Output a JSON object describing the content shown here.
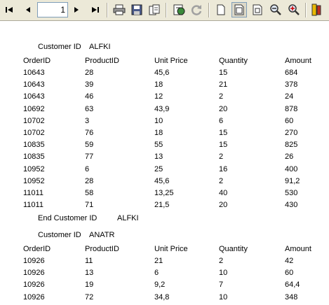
{
  "toolbar": {
    "page_number": "1",
    "buttons": [
      {
        "name": "first-page-icon"
      },
      {
        "name": "previous-page-icon"
      },
      {
        "name": "next-page-icon"
      },
      {
        "name": "last-page-icon"
      },
      {
        "name": "print-icon"
      },
      {
        "name": "save-icon"
      },
      {
        "name": "export-icon"
      },
      {
        "name": "stop-icon"
      },
      {
        "name": "refresh-icon"
      },
      {
        "name": "single-page-icon"
      },
      {
        "name": "page-width-icon"
      },
      {
        "name": "whole-page-icon"
      },
      {
        "name": "zoom-out-icon"
      },
      {
        "name": "zoom-in-icon"
      },
      {
        "name": "close-icon"
      }
    ]
  },
  "report": {
    "groups": [
      {
        "header_label": "Customer ID",
        "customer_id": "ALFKI",
        "columns": [
          "OrderID",
          "ProductID",
          "Unit Price",
          "Quantity",
          "Amount"
        ],
        "rows": [
          [
            "10643",
            "28",
            "45,6",
            "15",
            "684"
          ],
          [
            "10643",
            "39",
            "18",
            "21",
            "378"
          ],
          [
            "10643",
            "46",
            "12",
            "2",
            "24"
          ],
          [
            "10692",
            "63",
            "43,9",
            "20",
            "878"
          ],
          [
            "10702",
            "3",
            "10",
            "6",
            "60"
          ],
          [
            "10702",
            "76",
            "18",
            "15",
            "270"
          ],
          [
            "10835",
            "59",
            "55",
            "15",
            "825"
          ],
          [
            "10835",
            "77",
            "13",
            "2",
            "26"
          ],
          [
            "10952",
            "6",
            "25",
            "16",
            "400"
          ],
          [
            "10952",
            "28",
            "45,6",
            "2",
            "91,2"
          ],
          [
            "11011",
            "58",
            "13,25",
            "40",
            "530"
          ],
          [
            "11011",
            "71",
            "21,5",
            "20",
            "430"
          ]
        ],
        "footer_label": "End Customer ID",
        "footer_id": "ALFKI"
      },
      {
        "header_label": "Customer ID",
        "customer_id": "ANATR",
        "columns": [
          "OrderID",
          "ProductID",
          "Unit Price",
          "Quantity",
          "Amount"
        ],
        "rows": [
          [
            "10926",
            "11",
            "21",
            "2",
            "42"
          ],
          [
            "10926",
            "13",
            "6",
            "10",
            "60"
          ],
          [
            "10926",
            "19",
            "9,2",
            "7",
            "64,4"
          ],
          [
            "10926",
            "72",
            "34,8",
            "10",
            "348"
          ]
        ]
      }
    ]
  },
  "colors": {
    "toolbar_bg": "#ece9d8",
    "border": "#aca899",
    "pressed": "#dcd8c8"
  }
}
